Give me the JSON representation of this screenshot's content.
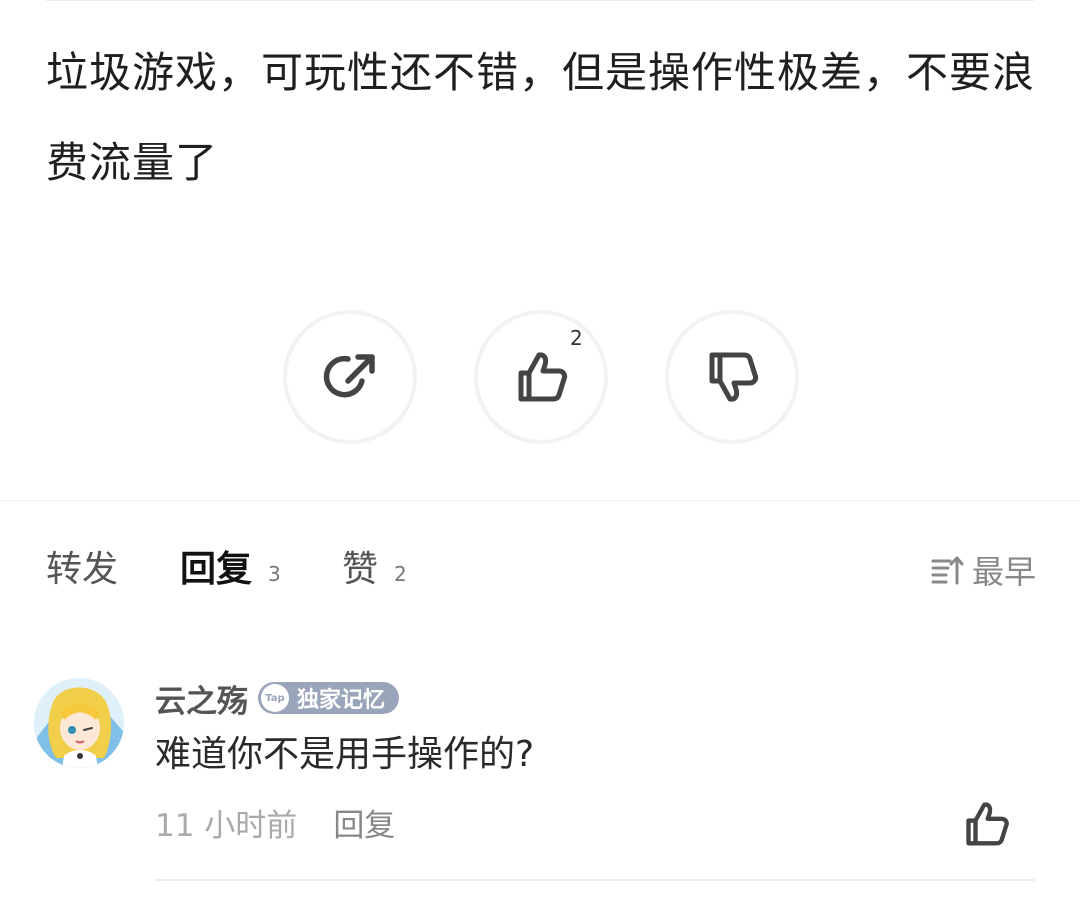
{
  "review": {
    "text": "垃圾游戏，可玩性还不错，但是操作性极差，不要浪费流量了"
  },
  "actions": {
    "share_icon": "share-icon",
    "like_icon": "thumbs-up-icon",
    "like_count": "2",
    "dislike_icon": "thumbs-down-icon"
  },
  "tabs": {
    "forward_label": "转发",
    "reply_label": "回复",
    "reply_count": "3",
    "like_label": "赞",
    "like_count": "2",
    "sort_icon": "sort-icon",
    "sort_label": "最早",
    "accent_color": "#16c6b4"
  },
  "comment": {
    "username": "云之殇",
    "badge_icon_text": "Tap",
    "badge_label": "独家记忆",
    "body": "难道你不是用手操作的?",
    "time": "11 小时前",
    "reply_label": "回复",
    "like_icon": "thumbs-up-icon"
  }
}
